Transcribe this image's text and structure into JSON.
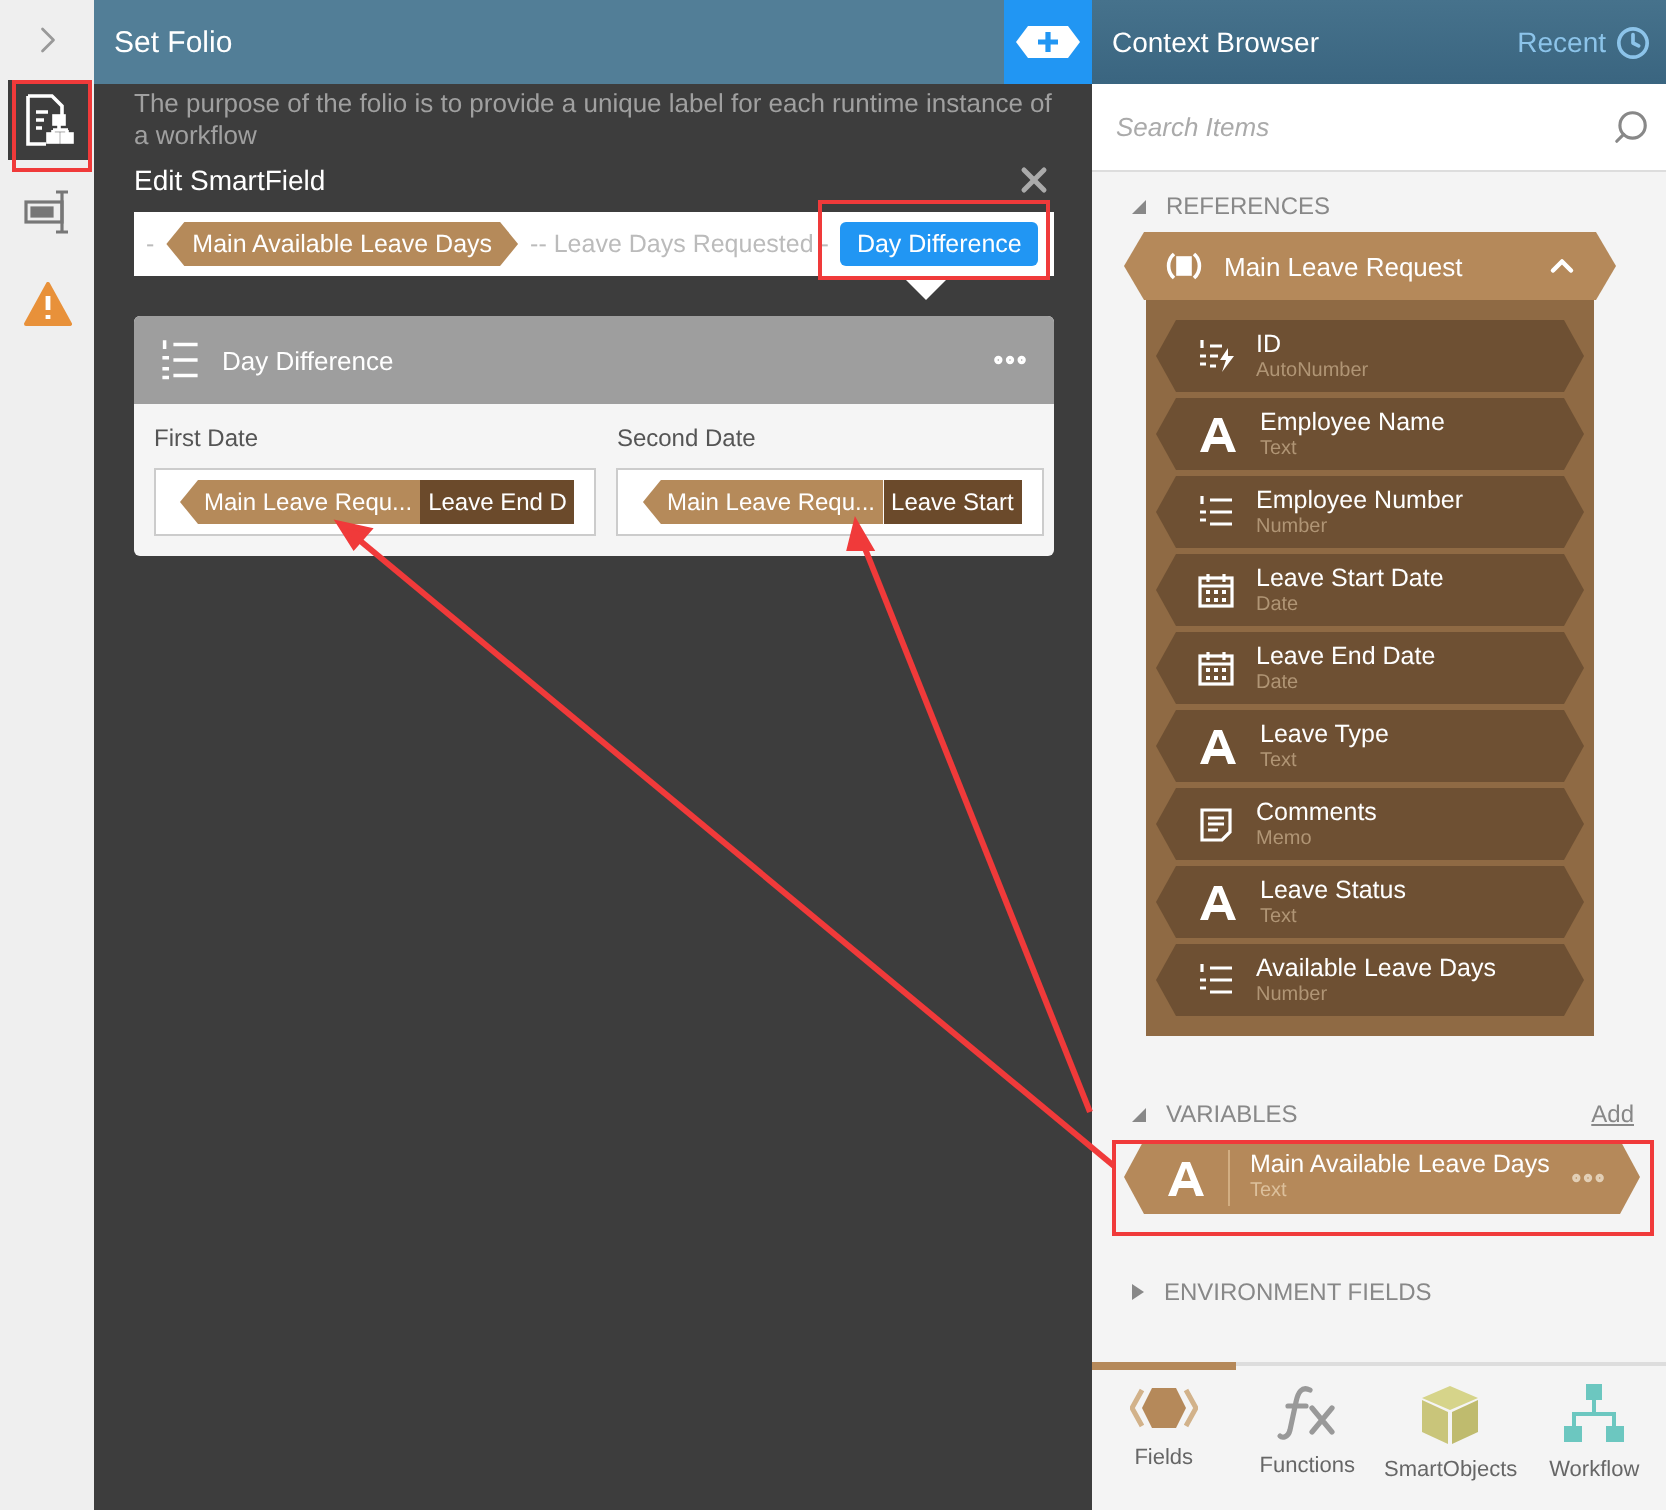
{
  "rail": {
    "items": [
      {
        "kind": "folio",
        "selected": true
      },
      {
        "kind": "form",
        "selected": false
      },
      {
        "kind": "warning",
        "selected": false
      }
    ]
  },
  "editor": {
    "title": "Set Folio",
    "description": "The purpose of the folio is to provide a unique label for each runtime instance of a workflow",
    "smartfield": {
      "title": "Edit SmartField",
      "expression": [
        {
          "kind": "text",
          "text": "-"
        },
        {
          "kind": "field",
          "text": "Main Available Leave Days",
          "selected": false
        },
        {
          "kind": "text",
          "text": "-- Leave Days Requested -"
        },
        {
          "kind": "function",
          "text": "Day Difference",
          "selected": true
        }
      ],
      "function": {
        "name": "Day Difference",
        "params": [
          {
            "label": "First Date",
            "reference": "Main Leave Requ...",
            "field": "Leave End D"
          },
          {
            "label": "Second Date",
            "reference": "Main Leave Requ...",
            "field": "Leave Start"
          }
        ]
      }
    }
  },
  "context_browser": {
    "title": "Context Browser",
    "recent": "Recent",
    "search_placeholder": "Search Items",
    "sections": [
      {
        "kind": "references",
        "label": "REFERENCES",
        "expanded": true,
        "groups": [
          {
            "name": "Main Leave Request",
            "expanded": true,
            "items": [
              {
                "name": "ID",
                "type": "AutoNumber",
                "kind": "autonumber"
              },
              {
                "name": "Employee Name",
                "type": "Text",
                "kind": "text"
              },
              {
                "name": "Employee Number",
                "type": "Number",
                "kind": "number"
              },
              {
                "name": "Leave Start Date",
                "type": "Date",
                "kind": "date"
              },
              {
                "name": "Leave End Date",
                "type": "Date",
                "kind": "date"
              },
              {
                "name": "Leave Type",
                "type": "Text",
                "kind": "text"
              },
              {
                "name": "Comments",
                "type": "Memo",
                "kind": "memo"
              },
              {
                "name": "Leave Status",
                "type": "Text",
                "kind": "text"
              },
              {
                "name": "Available Leave Days",
                "type": "Number",
                "kind": "number"
              }
            ]
          }
        ]
      },
      {
        "kind": "variables",
        "label": "VARIABLES",
        "expanded": true,
        "action": "Add",
        "items": [
          {
            "name": "Main Available Leave Days",
            "type": "Text",
            "kind": "text"
          }
        ]
      },
      {
        "kind": "environment",
        "label": "ENVIRONMENT FIELDS",
        "expanded": false
      }
    ]
  },
  "bottom_tabs": [
    {
      "label": "Fields",
      "kind": "fields",
      "selected": true
    },
    {
      "label": "Functions",
      "kind": "functions",
      "selected": false
    },
    {
      "label": "SmartObjects",
      "kind": "smartobjects",
      "selected": false
    },
    {
      "label": "Workflow",
      "kind": "workflow",
      "selected": false
    }
  ]
}
